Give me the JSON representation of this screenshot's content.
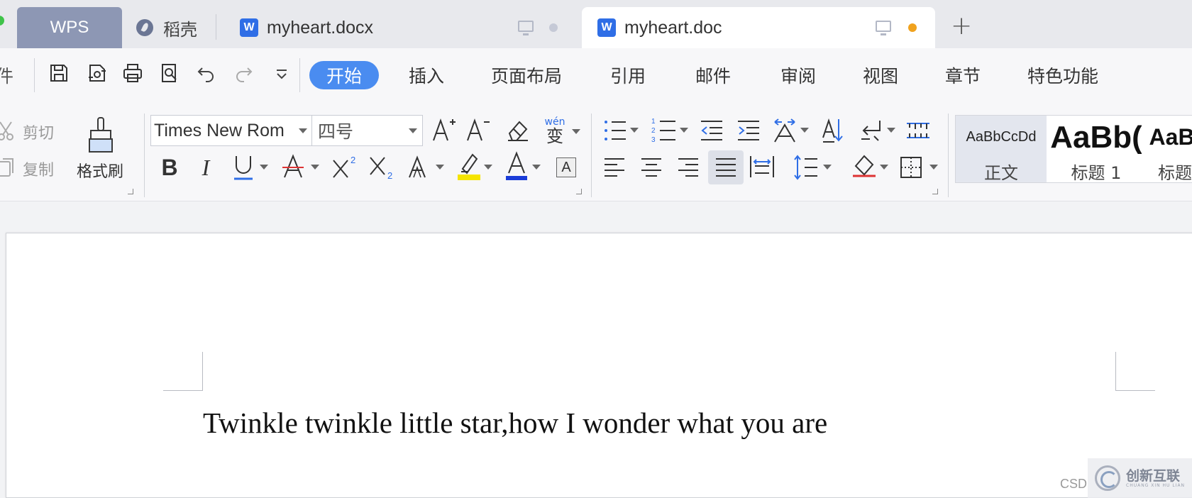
{
  "tabs": [
    {
      "label": "WPS"
    },
    {
      "label": "稻壳"
    },
    {
      "label": "myheart.docx"
    },
    {
      "label": "myheart.doc"
    }
  ],
  "tab_dot_colors": {
    "inactive": "#c5c9d6",
    "unsaved": "#f0a21e"
  },
  "quick_access": {
    "partial_label": "件",
    "icons": [
      "save-icon",
      "export-pdf-icon",
      "print-icon",
      "print-preview-icon",
      "undo-icon",
      "redo-icon",
      "customize-dropdown-icon"
    ]
  },
  "menu": {
    "items": [
      "开始",
      "插入",
      "页面布局",
      "引用",
      "邮件",
      "审阅",
      "视图",
      "章节",
      "特色功能"
    ],
    "active": "开始",
    "active_color": "#4a8cf0"
  },
  "clipboard": {
    "cut": "剪切",
    "copy": "复制",
    "format_painter": "格式刷"
  },
  "font": {
    "name": "Times New Rom",
    "size": "四号",
    "pinyin_label": "wén",
    "pinyin_char": "变",
    "highlight_color": "#f5e400",
    "font_color": "#1a3cd8",
    "border_char": "A"
  },
  "styles": [
    {
      "preview": "AaBbCcDd",
      "name": "正文"
    },
    {
      "preview": "AaBb(",
      "name": "标题 1"
    },
    {
      "preview": "AaBl",
      "name": "标题"
    }
  ],
  "document": {
    "text": "Twinkle twinkle little star,how I wonder what you are"
  },
  "watermark": {
    "csd": "CSD",
    "brand": "创新互联",
    "sub": "CHUANG XIN HU LIAN"
  }
}
